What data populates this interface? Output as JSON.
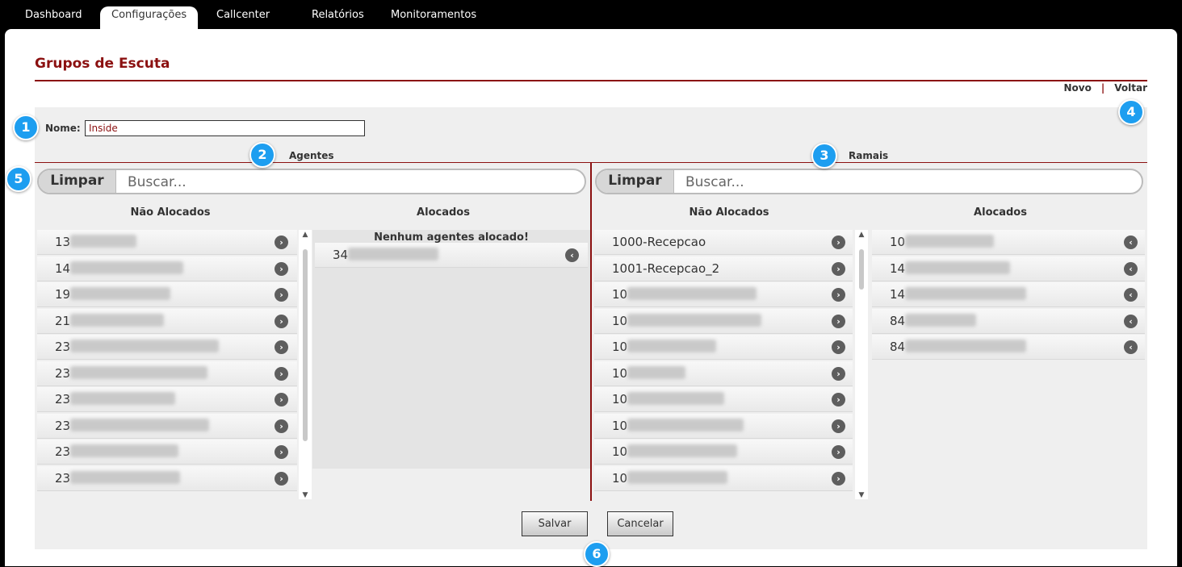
{
  "nav": {
    "tabs": [
      {
        "label": "Dashboard"
      },
      {
        "label": "Configurações"
      },
      {
        "label": "Callcenter"
      },
      {
        "label": "Relatórios"
      },
      {
        "label": "Monitoramentos"
      }
    ],
    "active": "Configurações"
  },
  "page": {
    "title": "Grupos de Escuta",
    "links": {
      "novo": "Novo",
      "separator": "|",
      "voltar": "Voltar"
    }
  },
  "form": {
    "nome_label": "Nome:",
    "nome_value": "Inside"
  },
  "agentes": {
    "heading": "Agentes",
    "clear_label": "Limpar",
    "search_placeholder": "Buscar...",
    "nao_alocados_heading": "Não Alocados",
    "alocados_heading": "Alocados",
    "empty_message": "Nenhum agentes alocado!",
    "nao_alocados": [
      "13",
      "14",
      "19",
      "21",
      "23",
      "23",
      "23",
      "23",
      "23",
      "23"
    ],
    "alocados": [
      "34"
    ]
  },
  "ramais": {
    "heading": "Ramais",
    "clear_label": "Limpar",
    "search_placeholder": "Buscar...",
    "nao_alocados_heading": "Não Alocados",
    "alocados_heading": "Alocados",
    "nao_alocados": [
      "1000-Recepcao",
      "1001-Recepcao_2",
      "10",
      "10",
      "10",
      "10",
      "10",
      "10",
      "10",
      "10"
    ],
    "alocados": [
      "10",
      "14",
      "14",
      "84",
      "84"
    ]
  },
  "actions": {
    "salvar": "Salvar",
    "cancelar": "Cancelar"
  },
  "badges": [
    "1",
    "2",
    "3",
    "4",
    "5",
    "6"
  ],
  "colors": {
    "accent": "#8b1010",
    "badge": "#1d9ef0",
    "nav_bg": "#000000"
  }
}
